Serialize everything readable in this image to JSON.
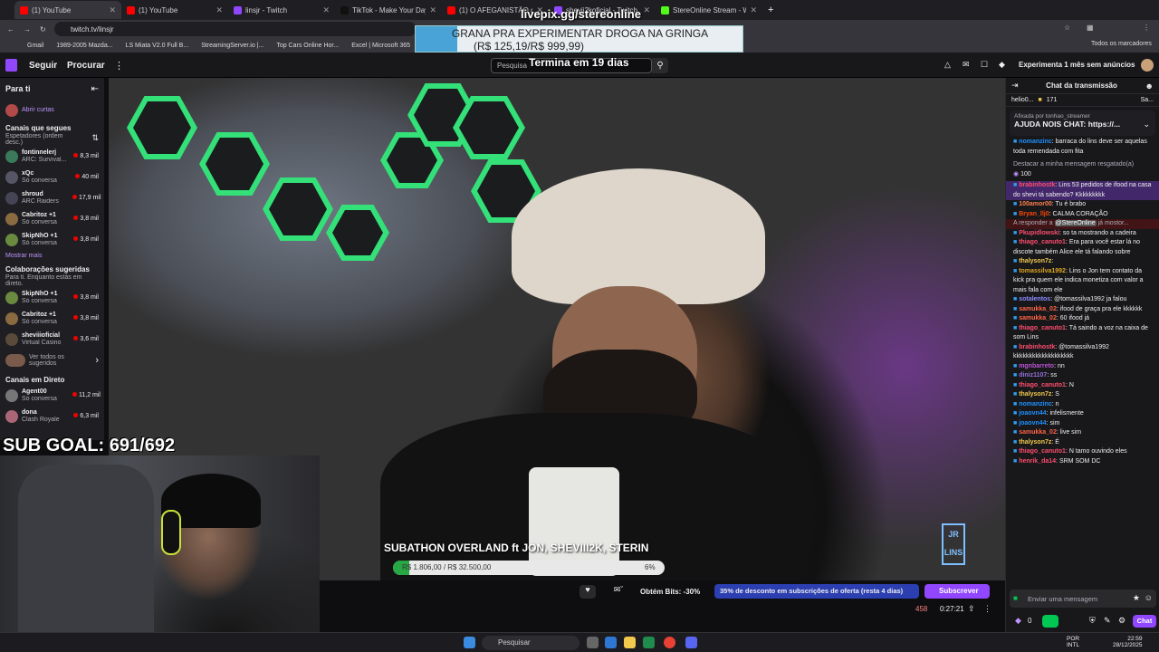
{
  "tabs": [
    {
      "title": "(1) YouTube",
      "fav": "#ff0000",
      "active": true
    },
    {
      "title": "(1) YouTube",
      "fav": "#ff0000"
    },
    {
      "title": "linsjr - Twitch",
      "fav": "#9147ff"
    },
    {
      "title": "TikTok - Make Your Day",
      "fav": "#111111"
    },
    {
      "title": "(1) O AFEGANISTÃO que ning...",
      "fav": "#ff0000"
    },
    {
      "title": "shevii2koficial - Twitch",
      "fav": "#9147ff"
    },
    {
      "title": "StereOnline Stream - Watch Li...",
      "fav": "#53fc18"
    }
  ],
  "address": {
    "url": "twitch.tv/linsjr"
  },
  "bookmarks": [
    "Gmail",
    "1989-2005 Mazda...",
    "LS Miata V2.0 Full B...",
    "StreamingServer.io |...",
    "Top Cars Online Hor...",
    "Excel | Microsoft 365",
    "T"
  ],
  "bookmarks_all": "Todos os marcadores",
  "overlay": {
    "livepix": "livepix.gg/stereonline",
    "ad_line1": "GRANA PRA EXPERIMENTAR DROGA NA GRINGA",
    "ad_line2": "(R$ 125,19/R$ 999,99)",
    "countdown": "Termina em 19 dias",
    "sub_goal": "SUB GOAL: 691/692",
    "subathon": "SUBATHON OVERLAND ft JON, SHEVIII2K, STERIN",
    "progress_text": "R$ 1.806,00 / R$ 32.500,00",
    "progress_pct": "6%",
    "progress_fraction": 0.06,
    "logo_text": "JR LINS"
  },
  "twitch": {
    "follow": "Seguir",
    "browse": "Procurar",
    "search_placeholder": "Pesquisa",
    "prime": "Experimenta 1 mês sem anúncios"
  },
  "sidebar": {
    "for_you": "Para ti",
    "clips": "Abrir curtas",
    "followed": "Canais que segues",
    "followed_sub": "Espetadores (ordem desc.)",
    "channels": [
      {
        "name": "fontinnelerj",
        "sub": "ARC: Survival...",
        "count": "8,3 mil",
        "color": "#3a7a5a"
      },
      {
        "name": "xQc",
        "sub": "Só conversa",
        "count": "40 mil",
        "color": "#556"
      },
      {
        "name": "shroud",
        "sub": "ARC Raiders",
        "count": "17,9 mil",
        "color": "#445"
      },
      {
        "name": "Cabritoz +1",
        "sub": "Só conversa",
        "count": "3,8 mil",
        "color": "#8a6a40"
      },
      {
        "name": "SkipNhO +1",
        "sub": "Só conversa",
        "count": "3,8 mil",
        "color": "#6a8a40"
      }
    ],
    "show_more": "Mostrar mais",
    "collab": "Colaborações sugeridas",
    "collab_sub": "Para ti. Enquanto estás em direto.",
    "collab_channels": [
      {
        "name": "SkipNhO +1",
        "sub": "Só conversa",
        "count": "3,8 mil",
        "color": "#6a8a40"
      },
      {
        "name": "Cabritoz +1",
        "sub": "Só conversa",
        "count": "3,8 mil",
        "color": "#8a6a40"
      },
      {
        "name": "sheviiioficial",
        "sub": "Virtual Casino",
        "count": "3,6 mil",
        "color": "#5a4a3a"
      }
    ],
    "see_all": "Ver todos os sugeridos",
    "live": "Canais em Direto",
    "live_channels": [
      {
        "name": "Agent00",
        "sub": "Só conversa",
        "count": "11,2 mil",
        "color": "#777"
      },
      {
        "name": "dona",
        "sub": "Clash Royale",
        "count": "6,3 mil",
        "color": "#a67"
      }
    ]
  },
  "player": {
    "bits": "Obtém Bits: -30%",
    "discount": "35% de desconto em subscrições de oferta (resta 4 dias)",
    "subscribe": "Subscrever",
    "viewers": "458",
    "uptime": "0:27:21"
  },
  "chat": {
    "header": "Chat da transmissão",
    "top_user": "helio0...",
    "top_count": "171",
    "top_right": "Sa...",
    "pinned_by": "Afixada por",
    "pinned_user": "tonhao_streamer",
    "pinned_text": "AJUDA NOIS CHAT: https://...",
    "redeem": "Destacar a minha mensagem resgatado(a)",
    "redeem_cost": "100",
    "reply_to": "A responder a",
    "reply_name": "@StereOnline",
    "reply_tail": "já mostor...",
    "messages": [
      {
        "user": "nomanzinc",
        "color": "#1e90ff",
        "text": "barraca do lins deve ser aquelas toda remendada com fita"
      },
      {
        "user": "brabinhostk",
        "color": "#ff4d6d",
        "text": "Lins 53 pedidos de ifood na casa do shevi tá sabendo? Kkkkkkkkk",
        "hl": true
      },
      {
        "user": "100amor00",
        "color": "#ff7f50",
        "text": "Tu é brabo"
      },
      {
        "user": "Bryan_llj0",
        "color": "#ff4500",
        "text": "CALMA CORAÇÃO"
      },
      {
        "user": "Pkupidlowski",
        "color": "#ff4d6d",
        "text": "so ta mostrando a cadeira"
      },
      {
        "user": "thiago_canuto1",
        "color": "#ff4d6d",
        "text": "Era para você estar lá no discote também Alice ele tá falando sobre"
      },
      {
        "user": "thalyson7z",
        "color": "#f2c94c",
        "text": ""
      },
      {
        "user": "tomassilva1992",
        "color": "#daa520",
        "text": "Lins o Jon tem contato da kick pra quem ele indica monetiza com valor a mais fala com ele"
      },
      {
        "user": "sotalentos",
        "color": "#8a8aff",
        "text": "@tomassilva1992 ja falou"
      },
      {
        "user": "samukka_02",
        "color": "#ff6347",
        "text": "ifood de graça pra ele kkkkkk"
      },
      {
        "user": "samukka_02",
        "color": "#ff6347",
        "text": "60 ifood já"
      },
      {
        "user": "thiago_canuto1",
        "color": "#ff4d6d",
        "text": "Tá saindo a voz na caixa de som Lins"
      },
      {
        "user": "brabinhostk",
        "color": "#ff4d6d",
        "text": "@tomassilva1992 kkkkkkkkkkkkkkkkkkk"
      },
      {
        "user": "mgnbarreto",
        "color": "#ba55d3",
        "text": "nn"
      },
      {
        "user": "diniz1107",
        "color": "#9370db",
        "text": "ss"
      },
      {
        "user": "thiago_canuto1",
        "color": "#ff4d6d",
        "text": "N"
      },
      {
        "user": "thalyson7z",
        "color": "#f2c94c",
        "text": "S"
      },
      {
        "user": "nomanzinc",
        "color": "#1e90ff",
        "text": "n"
      },
      {
        "user": "joaovn44",
        "color": "#1e90ff",
        "text": "infelismente"
      },
      {
        "user": "joaovn44",
        "color": "#1e90ff",
        "text": "sim"
      },
      {
        "user": "samukka_02",
        "color": "#ff6347",
        "text": "live sim"
      },
      {
        "user": "thalyson7z",
        "color": "#f2c94c",
        "text": "É"
      },
      {
        "user": "thiago_canuto1",
        "color": "#ff4d6d",
        "text": "N tamo ouvindo eles"
      },
      {
        "user": "henrik_da14",
        "color": "#ff4d6d",
        "text": "SRM SOM DC"
      }
    ],
    "input_placeholder": "Enviar uma mensagem",
    "points": "0",
    "chat_btn": "Chat"
  },
  "taskbar": {
    "search": "Pesquisar",
    "lang1": "POR",
    "lang2": "INTL",
    "time": "22:59",
    "date": "28/12/2025"
  }
}
